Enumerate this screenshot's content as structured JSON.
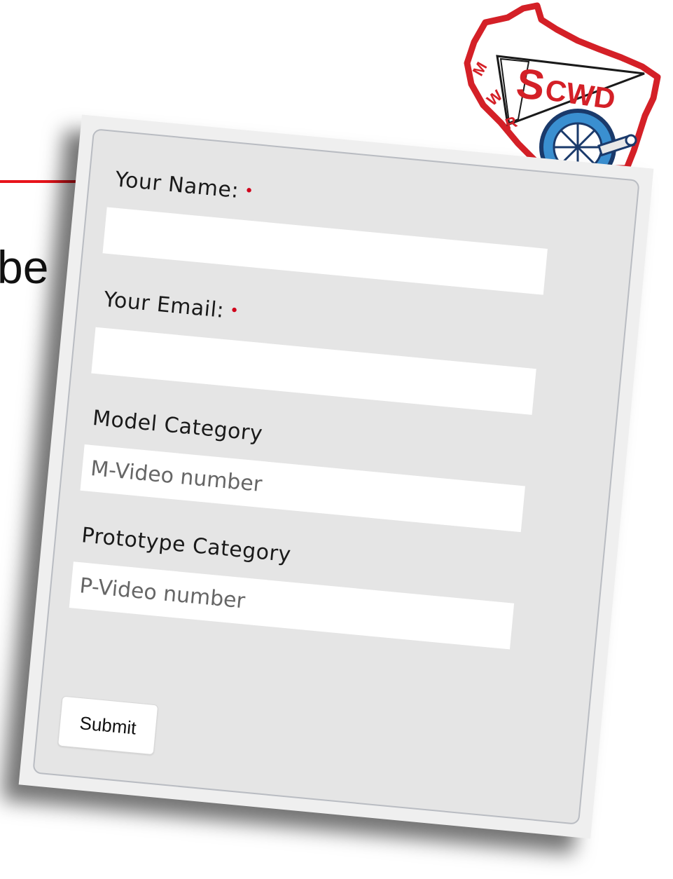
{
  "slide": {
    "text_fragment": "be"
  },
  "logo": {
    "label": "MWR SCWD",
    "colors": {
      "red": "#d42027",
      "blue": "#3a8fd0",
      "navy": "#1a3a6b"
    }
  },
  "form": {
    "name": {
      "label": "Your Name:",
      "required_mark": "•",
      "value": ""
    },
    "email": {
      "label": "Your Email:",
      "required_mark": "•",
      "value": ""
    },
    "model_category": {
      "label": "Model Category",
      "placeholder": "M-Video number"
    },
    "prototype_category": {
      "label": "Prototype Category",
      "placeholder": "P-Video number"
    },
    "submit_label": "Submit"
  },
  "colors": {
    "accent_red": "#e8141b",
    "required_red": "#d0021b",
    "panel_bg": "#e5e5e5"
  }
}
